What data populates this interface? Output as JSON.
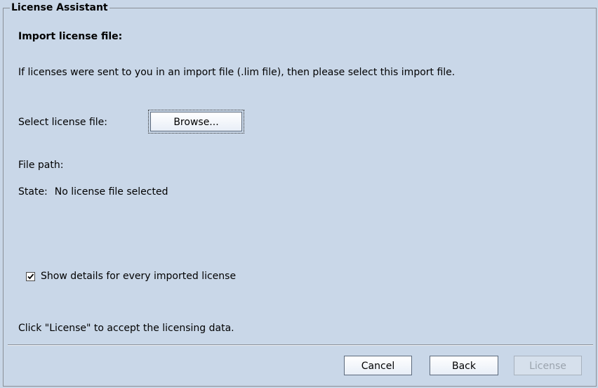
{
  "panel": {
    "title": "License Assistant",
    "heading": "Import license file:",
    "intro": "If licenses were sent to you in an import file (.lim file), then please select this import file.",
    "select_label": "Select license file:",
    "browse_label": "Browse...",
    "file_path_label": "File path:",
    "state_label": "State:",
    "state_value": "No license file selected",
    "show_details": {
      "label": "Show details for every imported license",
      "checked": true
    },
    "hint": "Click \"License\" to accept the licensing data."
  },
  "footer": {
    "cancel_label": "Cancel",
    "back_label": "Back",
    "license_label": "License",
    "license_enabled": false
  },
  "colors": {
    "background": "#c9d7e8",
    "border": "#8a8f96",
    "disabled_text": "#9aa3ad"
  }
}
